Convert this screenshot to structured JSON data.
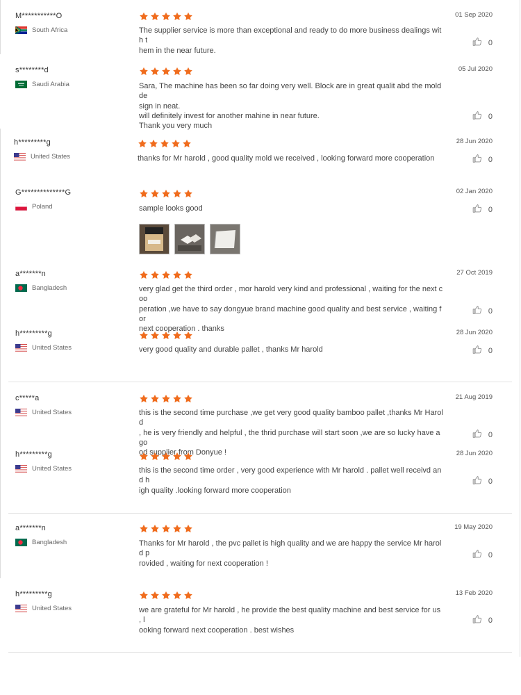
{
  "star_color": "#f06c1d",
  "reviews": [
    {
      "user": "M***********O",
      "country": "South Africa",
      "flag": "za",
      "date": "01 Sep 2020",
      "lines": [
        "The supplier service is more than exceptional and ready to do more business dealings with t",
        "hem in the near future."
      ],
      "likes": "0"
    },
    {
      "user": "s********d",
      "country": "Saudi Arabia",
      "flag": "sa",
      "date": "05 Jul 2020",
      "lines": [
        "Sara, The machine has been so far doing very well. Block are in great qualit abd the mold de",
        "sign in neat.",
        "will definitely invest for another mahine in near future.",
        "Thank you very much"
      ],
      "likes": "0"
    },
    {
      "user": "h*********g",
      "country": "United States",
      "flag": "us",
      "date": "28 Jun 2020",
      "lines": [
        "thanks for Mr harold , good quality mold we received , looking forward more cooperation"
      ],
      "likes": "0"
    },
    {
      "user": "G**************G",
      "country": "Poland",
      "flag": "pl",
      "date": "02 Jan 2020",
      "lines": [
        "sample looks good"
      ],
      "likes": "0",
      "images": [
        "review-photo-1",
        "review-photo-2",
        "review-photo-3"
      ]
    },
    {
      "user": "a*******n",
      "country": "Bangladesh",
      "flag": "bd",
      "date": "27 Oct 2019",
      "lines": [
        "very glad get the third order , mor harold very kind and professional , waiting for the next coo",
        "peration ,we have to say dongyue brand machine good quality and best service , waiting for",
        "next cooperation . thanks"
      ],
      "likes": "0"
    },
    {
      "user": "h*********g",
      "country": "United States",
      "flag": "us",
      "date": "28 Jun 2020",
      "lines": [
        "very good quality and durable pallet , thanks Mr harold"
      ],
      "likes": "0"
    },
    {
      "user": "c*****a",
      "country": "United States",
      "flag": "us",
      "date": "21 Aug 2019",
      "lines": [
        "this is the second time purchase ,we get very good quality bamboo pallet ,thanks Mr Harold",
        ", he is very friendly and helpful , the thrid purchase will start soon ,we are so lucky have a go",
        "od supplier from Donyue !"
      ],
      "likes": "0"
    },
    {
      "user": "h*********g",
      "country": "United States",
      "flag": "us",
      "date": "28 Jun 2020",
      "lines": [
        "this is the second time order , very good experience with Mr harold . pallet well receivd and h",
        "igh quality .looking forward more cooperation"
      ],
      "likes": "0"
    },
    {
      "user": "a*******n",
      "country": "Bangladesh",
      "flag": "bd",
      "date": "19 May 2020",
      "lines": [
        "Thanks for Mr harold , the pvc pallet is high quality and we are happy the service Mr harold p",
        "rovided , waiting for next cooperation !"
      ],
      "likes": "0"
    },
    {
      "user": "h*********g",
      "country": "United States",
      "flag": "us",
      "date": "13 Feb 2020",
      "lines": [
        "we are grateful for Mr harold , he provide the best quality machine and best service for us , l",
        "ooking forward next cooperation . best wishes"
      ],
      "likes": "0"
    }
  ]
}
